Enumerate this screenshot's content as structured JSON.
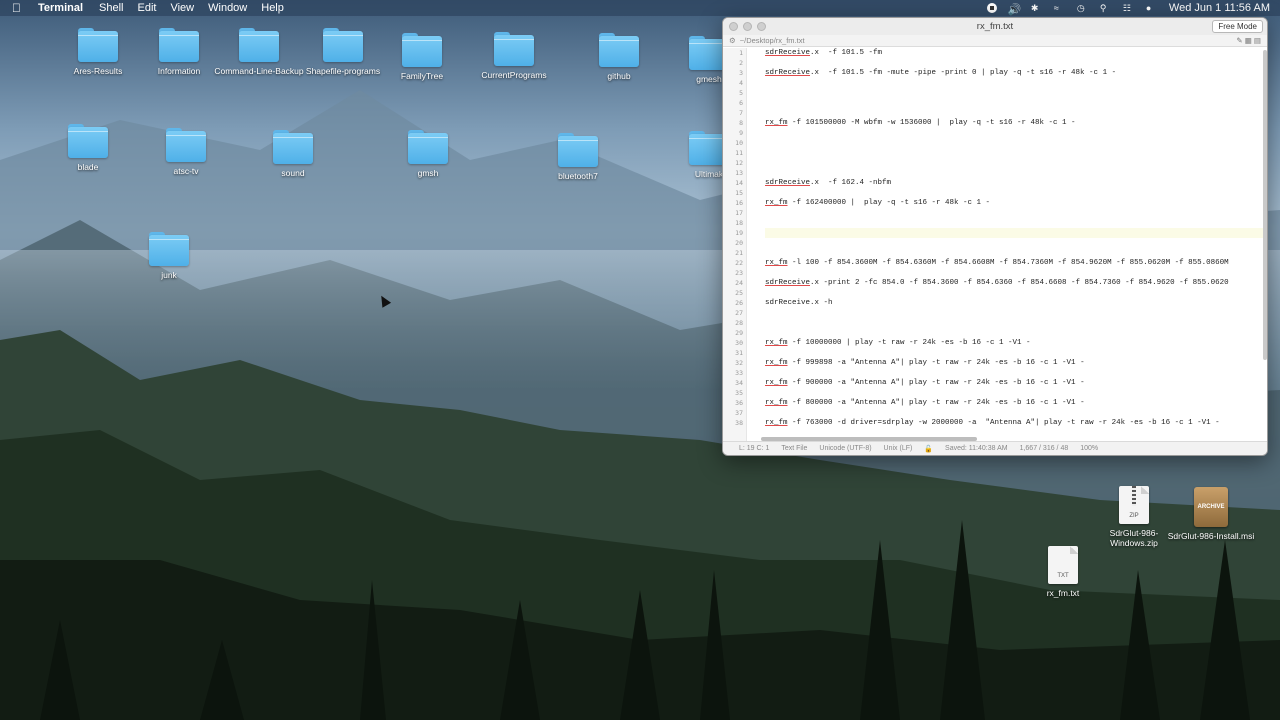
{
  "menubar": {
    "app": "Terminal",
    "items": [
      "Shell",
      "Edit",
      "View",
      "Window",
      "Help"
    ],
    "clock": "Wed Jun 1  11:56 AM"
  },
  "desktop": {
    "folders": [
      "Ares-Results",
      "Information",
      "Command-Line-Backup",
      "Shapefile-programs",
      "FamilyTree",
      "CurrentPrograms",
      "github",
      "gmesh",
      "blade",
      "atsc-tv",
      "sound",
      "gmsh",
      "bluetooth7",
      "Ultimak",
      "junk"
    ],
    "files": {
      "zip": {
        "label": "SdrGlut-986-Windows.zip",
        "ext": "ZIP"
      },
      "msi": {
        "label": "SdrGlut-986-Install.msi",
        "ext": "ARCHIVE"
      },
      "txt": {
        "label": "rx_fm.txt",
        "ext": "TXT"
      }
    }
  },
  "window": {
    "title": "rx_fm.txt",
    "free_mode": "Free Mode",
    "path": "~/Desktop/rx_fm.txt",
    "lines": [
      "sdrReceive.x  -f 101.5 -fm",
      "",
      "sdrReceive.x  -f 101.5 -fm -mute -pipe -print 0 | play -q -t s16 -r 48k -c 1 -",
      "",
      "",
      "",
      "",
      "rx_fm -f 101500000 -M wbfm -w 1536000 |  play -q -t s16 -r 48k -c 1 -",
      "",
      "",
      "",
      "",
      "",
      "sdrReceive.x  -f 162.4 -nbfm",
      "",
      "rx_fm -f 162400000 |  play -q -t s16 -r 48k -c 1 -",
      "",
      "",
      "",
      "",
      "",
      "rx_fm -l 100 -f 854.3600M -f 854.6360M -f 854.6608M -f 854.7360M -f 854.9620M -f 855.0620M -f 855.0860M",
      "",
      "sdrReceive.x -print 2 -fc 854.0 -f 854.3600 -f 854.6360 -f 854.6608 -f 854.7360 -f 854.9620 -f 855.0620",
      "",
      "sdrReceive.x -h",
      "",
      "",
      "",
      "rx_fm -f 10000000 | play -t raw -r 24k -es -b 16 -c 1 -V1 -",
      "",
      "rx_fm -f 999898 -a \"Antenna A\"| play -t raw -r 24k -es -b 16 -c 1 -V1 -",
      "",
      "rx_fm -f 900000 -a \"Antenna A\"| play -t raw -r 24k -es -b 16 -c 1 -V1 -",
      "",
      "rx_fm -f 800000 -a \"Antenna A\"| play -t raw -r 24k -es -b 16 -c 1 -V1 -",
      "",
      "rx_fm -f 763000 -d driver=sdrplay -w 2000000 -a  \"Antenna A\"| play -t raw -r 24k -es -b 16 -c 1 -V1 -"
    ],
    "status": {
      "position": "L: 19 C: 1",
      "file_type": "Text File",
      "encoding": "Unicode (UTF-8)",
      "line_endings": "Unix (LF)",
      "saved": "Saved: 11:40:38 AM",
      "counts": "1,667 / 316 / 48",
      "zoom": "100%"
    }
  }
}
